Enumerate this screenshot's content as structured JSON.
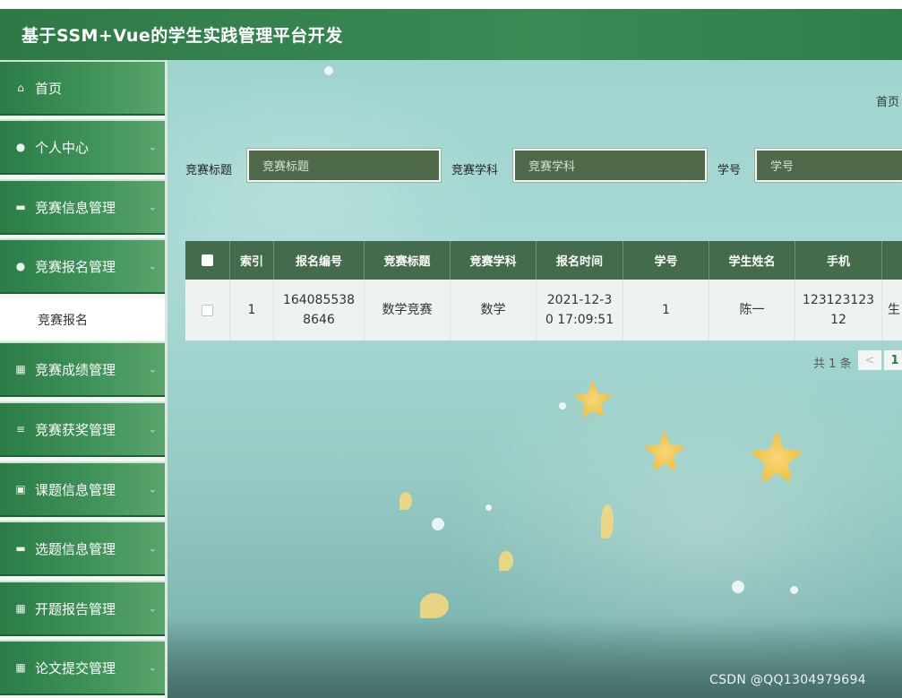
{
  "app": {
    "title": "基于SSM+Vue的学生实践管理平台开发"
  },
  "sidebar": {
    "items": [
      {
        "label": "首页",
        "icon": "home-icon"
      },
      {
        "label": "个人中心",
        "icon": "user-icon"
      },
      {
        "label": "竞赛信息管理",
        "icon": "document-icon"
      },
      {
        "label": "竞赛报名管理",
        "icon": "location-icon"
      },
      {
        "label": "竞赛成绩管理",
        "icon": "grid-icon"
      },
      {
        "label": "竞赛获奖管理",
        "icon": "list-icon"
      },
      {
        "label": "课题信息管理",
        "icon": "clipboard-icon"
      },
      {
        "label": "选题信息管理",
        "icon": "monitor-icon"
      },
      {
        "label": "开题报告管理",
        "icon": "grid-icon"
      },
      {
        "label": "论文提交管理",
        "icon": "grid-icon"
      }
    ],
    "submenu": {
      "label": "竞赛报名"
    }
  },
  "breadcrumb": {
    "home": "首页"
  },
  "search": {
    "title_label": "竞赛标题",
    "title_placeholder": "竞赛标题",
    "subject_label": "竞赛学科",
    "subject_placeholder": "竞赛学科",
    "student_id_label": "学号",
    "student_id_placeholder": "学号"
  },
  "table": {
    "headers": [
      "索引",
      "报名编号",
      "竞赛标题",
      "竞赛学科",
      "报名时间",
      "学号",
      "学生姓名",
      "手机"
    ],
    "rows": [
      {
        "index": "1",
        "reg_no_1": "164085538",
        "reg_no_2": "8646",
        "title": "数学竞赛",
        "subject": "数学",
        "time_1": "2021-12-3",
        "time_2": "0 17:09:51",
        "student_id": "1",
        "name": "陈一",
        "phone_1": "123123123",
        "phone_2": "12",
        "extra": "生"
      }
    ]
  },
  "pagination": {
    "total_text": "共 1 条",
    "prev": "<",
    "current_page": "1"
  },
  "watermark": "CSDN @QQ1304979694",
  "colors": {
    "header": "#2e7a46",
    "sidebar_item": "#3f9258",
    "table_header": "#446b4c",
    "search_input": "#4f6a4b"
  }
}
